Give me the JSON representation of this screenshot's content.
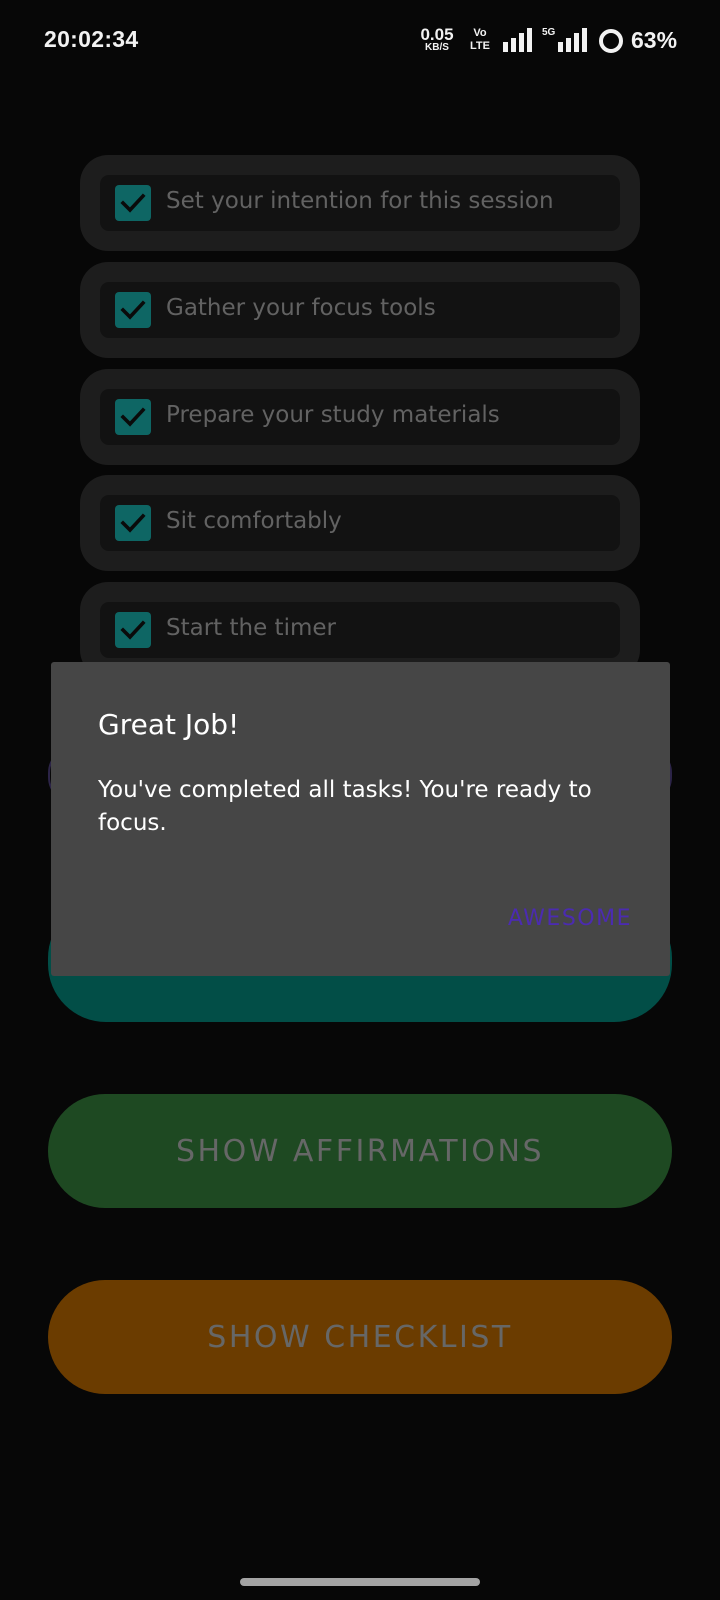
{
  "status_bar": {
    "time": "20:02:34",
    "net_speed_value": "0.05",
    "net_speed_unit": "KB/S",
    "volte_line1": "Vo",
    "volte_line2": "LTE",
    "network_5g": "5G",
    "battery_percent": "63%"
  },
  "checklist": {
    "items": [
      {
        "label": "Set your intention for this session",
        "checked": true
      },
      {
        "label": "Gather your focus tools",
        "checked": true
      },
      {
        "label": "Prepare your study materials",
        "checked": true
      },
      {
        "label": "Sit comfortably",
        "checked": true
      },
      {
        "label": "Start the timer",
        "checked": true
      }
    ]
  },
  "buttons": {
    "affirmations_label": "SHOW AFFIRMATIONS",
    "checklist_label": "SHOW CHECKLIST"
  },
  "dialog": {
    "title": "Great Job!",
    "message": "You've completed all tasks! You're ready to focus.",
    "action_label": "AWESOME"
  },
  "colors": {
    "background": "#070707",
    "checkbox": "#0e6664",
    "affirmations_button": "#1e4922",
    "checklist_button": "#6b3c00",
    "teal_button": "#024e47",
    "dialog": "#464646",
    "dialog_action": "#4b2bb0"
  }
}
